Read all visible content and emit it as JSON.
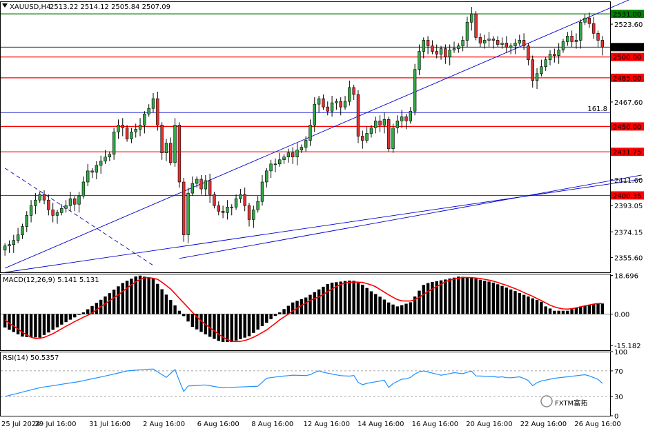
{
  "header": {
    "symbol": "XAUUSD,H4",
    "ohlc": "2513.22 2514.12 2505.84 2507.09"
  },
  "colors": {
    "bull": "#32a844",
    "bear": "#e03030",
    "level_red": "#ff0000",
    "level_green": "#008000",
    "channel": "#0000cd",
    "macd_hist": "#000000",
    "macd_signal": "#ff0000",
    "rsi_line": "#1e90ff"
  },
  "chart_data": [
    {
      "type": "candlestick",
      "title": "XAUUSD,H4",
      "ylim": [
        2345,
        2540
      ],
      "y_ticks": [
        "2523.60",
        "2467.60",
        "2411.60",
        "2393.05",
        "2374.15",
        "2355.60"
      ],
      "price_tags": [
        {
          "label": "2531.00",
          "value": 2531.0,
          "kind": "green"
        },
        {
          "label": "2507.09",
          "value": 2507.09,
          "kind": "current"
        },
        {
          "label": "2500.00",
          "value": 2500.0,
          "kind": "red"
        },
        {
          "label": "2485.00",
          "value": 2485.0,
          "kind": "red"
        },
        {
          "label": "2450.00",
          "value": 2450.0,
          "kind": "red"
        },
        {
          "label": "2431.75",
          "value": 2431.75,
          "kind": "red"
        },
        {
          "label": "2400.35",
          "value": 2400.35,
          "kind": "red"
        }
      ],
      "fib_level": {
        "label": "161.8",
        "value": 2460.0
      },
      "x_labels": [
        "25 Jul 2024",
        "29 Jul 16:00",
        "31 Jul 16:00",
        "2 Aug 16:00",
        "6 Aug 16:00",
        "8 Aug 16:00",
        "12 Aug 16:00",
        "14 Aug 16:00",
        "16 Aug 16:00",
        "20 Aug 16:00",
        "22 Aug 16:00",
        "26 Aug 16:00"
      ],
      "closes": [
        2364,
        2365,
        2368,
        2372,
        2378,
        2386,
        2393,
        2397,
        2401,
        2397,
        2390,
        2386,
        2388,
        2391,
        2393,
        2398,
        2394,
        2400,
        2410,
        2418,
        2417,
        2422,
        2425,
        2428,
        2430,
        2446,
        2451,
        2449,
        2441,
        2446,
        2448,
        2451,
        2459,
        2463,
        2470,
        2451,
        2431,
        2438,
        2424,
        2451,
        2410,
        2372,
        2402,
        2409,
        2412,
        2405,
        2411,
        2401,
        2393,
        2389,
        2388,
        2392,
        2392,
        2398,
        2401,
        2393,
        2383,
        2390,
        2396,
        2410,
        2418,
        2423,
        2423,
        2426,
        2428,
        2431,
        2428,
        2433,
        2435,
        2440,
        2451,
        2466,
        2470,
        2464,
        2461,
        2467,
        2468,
        2464,
        2468,
        2478,
        2473,
        2443,
        2440,
        2445,
        2449,
        2454,
        2451,
        2455,
        2434,
        2449,
        2454,
        2457,
        2454,
        2461,
        2491,
        2504,
        2512,
        2508,
        2504,
        2502,
        2506,
        2500,
        2505,
        2506,
        2508,
        2512,
        2525,
        2531,
        2514,
        2510,
        2512,
        2513,
        2512,
        2509,
        2510,
        2507,
        2508,
        2510,
        2512,
        2508,
        2498,
        2483,
        2488,
        2493,
        2498,
        2502,
        2501,
        2505,
        2511,
        2515,
        2511,
        2512,
        2525,
        2528,
        2524,
        2517,
        2512,
        2507.09
      ]
    },
    {
      "type": "histogram+line",
      "title": "MACD(12,26,9) 5.141 5.131",
      "ylim": [
        -17.5,
        19.5
      ],
      "y_ticks": [
        "18.696",
        "0.00",
        "-15.182"
      ],
      "macd": [
        -6.5,
        -7.6,
        -8.7,
        -9.8,
        -10.9,
        -11.1,
        -11.2,
        -11.3,
        -11.4,
        -10.1,
        -8.9,
        -7.6,
        -6.4,
        -5.1,
        -3.9,
        -2.7,
        -1.6,
        -0.4,
        0.8,
        2.3,
        3.9,
        5.4,
        6.9,
        8.5,
        10.1,
        11.8,
        13.4,
        15.0,
        16.1,
        17.1,
        18.2,
        18.6,
        18.1,
        17.6,
        17.2,
        14.6,
        12.0,
        9.4,
        6.8,
        4.2,
        1.6,
        -1.0,
        -3.6,
        -6.2,
        -7.4,
        -8.6,
        -9.8,
        -11.0,
        -12.0,
        -13.0,
        -13.5,
        -13.5,
        -13.5,
        -12.8,
        -12.1,
        -11.4,
        -10.7,
        -9.1,
        -7.5,
        -5.8,
        -4.2,
        -2.5,
        -0.9,
        0.8,
        2.4,
        4.0,
        5.6,
        6.4,
        7.2,
        8.0,
        9.3,
        10.6,
        11.9,
        13.2,
        14.5,
        15.2,
        15.4,
        15.7,
        16.0,
        16.2,
        16.1,
        15.2,
        14.2,
        12.6,
        11.0,
        9.7,
        8.4,
        7.0,
        5.6,
        4.6,
        3.7,
        4.3,
        5.0,
        5.7,
        8.5,
        11.3,
        14.1,
        15.0,
        15.5,
        15.9,
        16.3,
        16.7,
        17.2,
        17.6,
        18.1,
        18.0,
        17.8,
        17.4,
        17.1,
        16.6,
        16.1,
        15.7,
        15.2,
        14.4,
        13.6,
        12.8,
        11.9,
        11.1,
        10.2,
        9.3,
        8.5,
        7.6,
        6.8,
        5.9,
        3.7,
        2.7,
        1.6,
        1.6,
        1.6,
        1.6,
        2.3,
        3.0,
        3.7,
        4.0,
        4.4,
        4.9,
        5.2,
        5.1
      ],
      "signal": [
        -2.8,
        -4.5,
        -5.8,
        -7.2,
        -8.8,
        -10.1,
        -11.2,
        -11.8,
        -11.7,
        -11.3,
        -10.4,
        -9.5,
        -8.3,
        -7.1,
        -5.9,
        -4.8,
        -3.6,
        -2.6,
        -1.5,
        -0.6,
        0.6,
        2.1,
        3.6,
        5.0,
        6.5,
        7.9,
        9.3,
        10.9,
        12.6,
        14.1,
        15.6,
        16.7,
        17.5,
        17.6,
        17.3,
        16.8,
        15.4,
        13.8,
        12.1,
        9.9,
        7.6,
        5.4,
        3.1,
        0.8,
        -1.3,
        -3.3,
        -5.0,
        -6.6,
        -8.1,
        -9.7,
        -11.2,
        -12.3,
        -13.1,
        -13.3,
        -13.2,
        -12.8,
        -12.1,
        -11.2,
        -10.1,
        -8.9,
        -7.7,
        -6.1,
        -4.5,
        -2.8,
        -1.4,
        0.0,
        1.5,
        2.8,
        4.2,
        5.4,
        6.6,
        7.5,
        8.3,
        9.5,
        10.8,
        12.1,
        13.3,
        14.3,
        15.0,
        15.3,
        15.5,
        15.4,
        15.3,
        14.7,
        14.1,
        13.2,
        11.9,
        10.6,
        9.3,
        8.1,
        7.0,
        6.4,
        6.3,
        6.3,
        7.0,
        8.1,
        9.5,
        10.9,
        12.1,
        13.3,
        14.4,
        15.6,
        16.4,
        16.9,
        17.3,
        17.7,
        17.7,
        17.6,
        17.4,
        17.2,
        16.8,
        16.4,
        15.9,
        15.3,
        14.6,
        13.9,
        13.1,
        12.3,
        11.4,
        10.4,
        9.5,
        8.6,
        7.5,
        6.5,
        5.4,
        4.3,
        3.5,
        2.9,
        2.5,
        2.4,
        2.6,
        3.0,
        3.5,
        4.0,
        4.4,
        4.8,
        5.1,
        5.1
      ]
    },
    {
      "type": "line",
      "title": "RSI(14) 50.5357",
      "ylim": [
        0,
        100
      ],
      "y_ticks": [
        "100",
        "70",
        "30",
        "0"
      ],
      "levels": [
        70,
        30
      ],
      "values": [
        30.0,
        31.7,
        33.5,
        35.2,
        36.9,
        38.6,
        40.4,
        42.1,
        43.8,
        44.9,
        45.9,
        47.0,
        48.0,
        49.1,
        50.1,
        51.2,
        52.2,
        53.3,
        54.7,
        56.2,
        57.6,
        59.1,
        60.5,
        62.0,
        63.6,
        65.1,
        66.7,
        68.3,
        69.9,
        70.5,
        71.1,
        71.7,
        72.3,
        72.6,
        72.9,
        68.6,
        64.2,
        59.9,
        66.1,
        72.2,
        54.1,
        38.0,
        46.4,
        46.8,
        47.3,
        47.7,
        48.1,
        46.9,
        45.7,
        44.5,
        43.6,
        43.9,
        44.2,
        44.6,
        44.9,
        45.2,
        45.5,
        45.8,
        46.1,
        52.3,
        58.5,
        59.5,
        60.4,
        61.2,
        61.9,
        62.6,
        63.3,
        63.1,
        62.9,
        62.7,
        64.1,
        67.5,
        70.0,
        67.9,
        66.4,
        65.1,
        63.8,
        62.6,
        62.2,
        61.8,
        62.8,
        52.1,
        48.4,
        50.5,
        51.7,
        53.0,
        54.2,
        55.5,
        44.1,
        50.1,
        53.6,
        57.1,
        57.5,
        59.8,
        65.2,
        68.5,
        70.0,
        68.3,
        66.6,
        64.9,
        63.2,
        64.5,
        65.8,
        67.2,
        66.4,
        65.6,
        68.0,
        69.6,
        62.1,
        61.9,
        61.7,
        61.4,
        61.2,
        60.1,
        60.7,
        59.5,
        59.3,
        60.0,
        60.7,
        58.3,
        54.9,
        46.9,
        51.6,
        54.2,
        55.6,
        57.0,
        58.5,
        59.3,
        60.1,
        60.8,
        61.6,
        62.4,
        63.2,
        64.0,
        62.2,
        59.5,
        56.8,
        50.5357
      ]
    }
  ],
  "watermark": {
    "text": "FXTM富拓"
  }
}
